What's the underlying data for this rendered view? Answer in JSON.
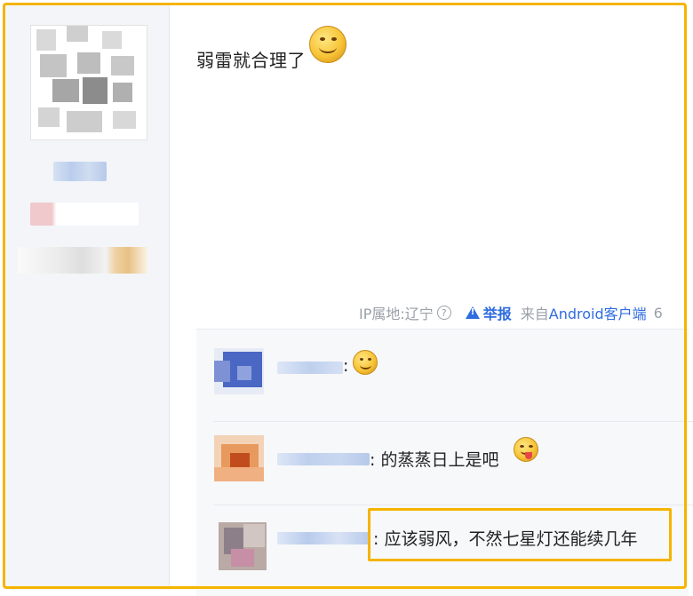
{
  "post": {
    "text": "弱雷就合理了",
    "emoji": "smiley-face-emoji"
  },
  "meta": {
    "ip_location": "IP属地:辽宁",
    "help_icon": "?",
    "report_label": "举报",
    "source_prefix": "来自",
    "source_link": "Android客户端",
    "trailing": "6"
  },
  "replies": [
    {
      "name_prefix": ":",
      "text": "",
      "emoji": "smiley-face-emoji"
    },
    {
      "name_prefix": ":",
      "text": "的蒸蒸日上是吧",
      "emoji": "tongue-out-emoji"
    },
    {
      "name_prefix": ":",
      "text": "应该弱风，不然七星灯还能续几年",
      "emoji": ""
    }
  ],
  "colors": {
    "highlight": "#f5b400",
    "link": "#2f6ce0",
    "meta_gray": "#9aa0a8"
  }
}
